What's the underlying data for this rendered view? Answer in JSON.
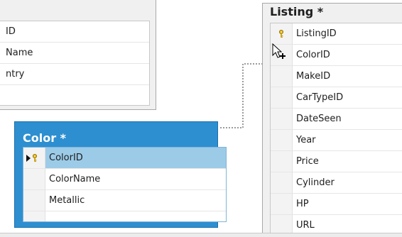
{
  "left_table": {
    "rows": [
      "ID",
      "Name",
      "ntry"
    ]
  },
  "color_table": {
    "title": "Color *",
    "rows": [
      "ColorID",
      "ColorName",
      "Metallic"
    ]
  },
  "listing_table": {
    "title": "Listing *",
    "rows": [
      "ListingID",
      "ColorID",
      "MakeID",
      "CarTypeID",
      "DateSeen",
      "Year",
      "Price",
      "Cylinder",
      "HP",
      "URL"
    ]
  },
  "colors": {
    "selected_header": "#2d8fd0",
    "selected_row": "#9ccbe8",
    "key_gold": "#e3b300"
  }
}
